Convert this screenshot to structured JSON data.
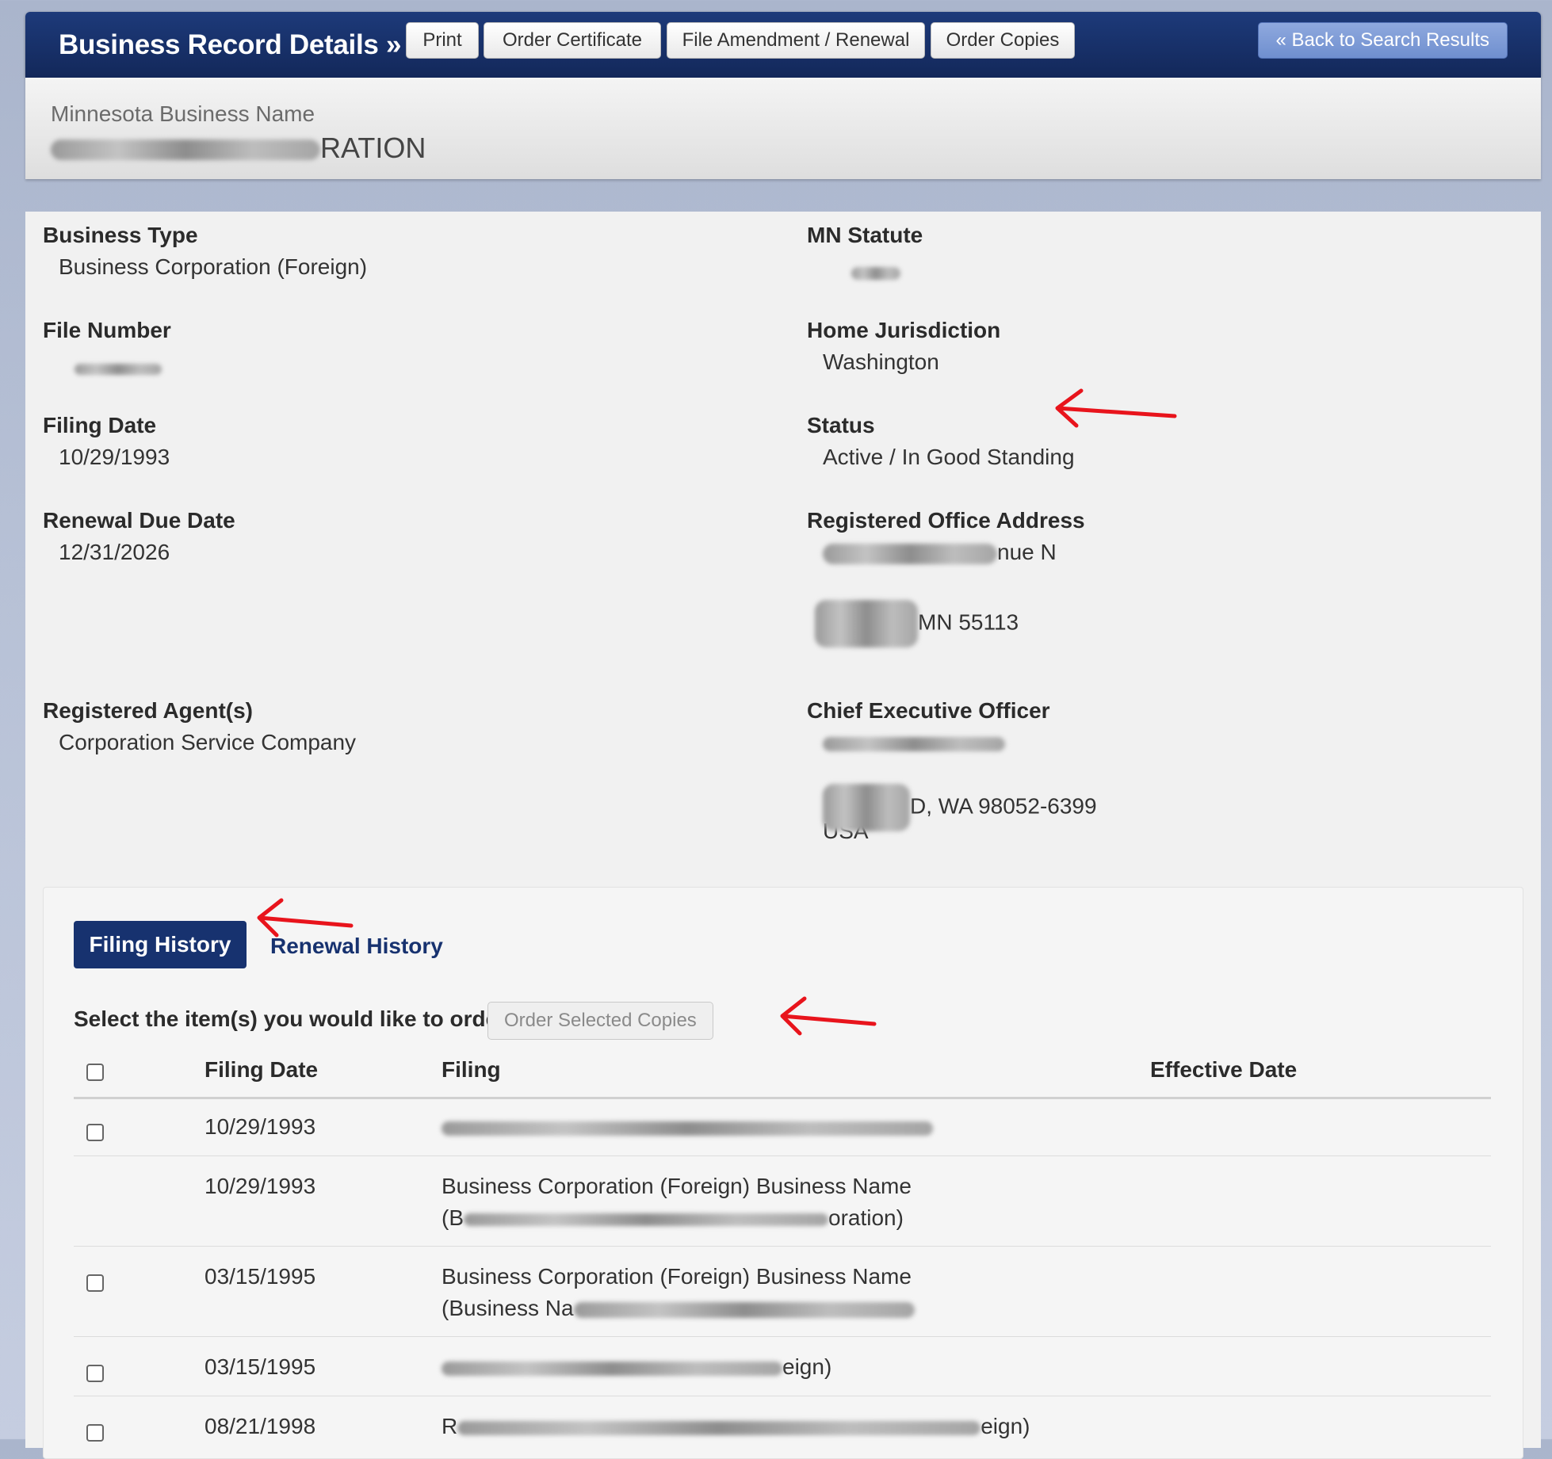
{
  "header": {
    "title": "Business Record Details »",
    "buttons": {
      "print": "Print",
      "order_certificate": "Order Certificate",
      "file_amendment": "File Amendment / Renewal",
      "order_copies": "Order Copies"
    },
    "back_button": "« Back to Search Results"
  },
  "name_bar": {
    "label": "Minnesota Business Name",
    "value_visible_suffix": "RATION"
  },
  "fields": {
    "business_type": {
      "label": "Business Type",
      "value": "Business Corporation (Foreign)"
    },
    "mn_statute": {
      "label": "MN Statute"
    },
    "file_number": {
      "label": "File Number"
    },
    "home_jurisdiction": {
      "label": "Home Jurisdiction",
      "value": "Washington"
    },
    "filing_date": {
      "label": "Filing Date",
      "value": "10/29/1993"
    },
    "status": {
      "label": "Status",
      "value": "Active / In Good Standing"
    },
    "renewal_due_date": {
      "label": "Renewal Due Date",
      "value": "12/31/2026"
    },
    "registered_office": {
      "label": "Registered Office Address",
      "line1_suffix": "nue N",
      "line2_suffix": "MN 55113"
    },
    "registered_agent": {
      "label": "Registered Agent(s)",
      "value": "Corporation Service Company"
    },
    "ceo": {
      "label": "Chief Executive Officer",
      "line2_suffix": "D, WA 98052-6399",
      "line3": "USA"
    }
  },
  "history": {
    "tab_active": "Filing History",
    "tab_inactive": "Renewal History",
    "order_prompt": "Select the item(s) you would like to order:",
    "order_button": "Order Selected Copies",
    "columns": {
      "filing_date": "Filing Date",
      "filing": "Filing",
      "effective_date": "Effective Date"
    },
    "rows": [
      {
        "date": "10/29/1993",
        "line1": "",
        "line2": ""
      },
      {
        "date": "10/29/1993",
        "line1": "Business Corporation (Foreign) Business Name",
        "line2_prefix": "(B",
        "line2_suffix": "oration)"
      },
      {
        "date": "03/15/1995",
        "line1": "Business Corporation (Foreign) Business Name",
        "line2_prefix": "(Business Na"
      },
      {
        "date": "03/15/1995",
        "line1_suffix": "eign)"
      },
      {
        "date": "08/21/1998",
        "line1_prefix": "R",
        "line1_suffix": "eign)"
      }
    ]
  },
  "colors": {
    "navy": "#17326f",
    "header_blue": "#1d3a7a",
    "annotation_red": "#e8141c"
  }
}
